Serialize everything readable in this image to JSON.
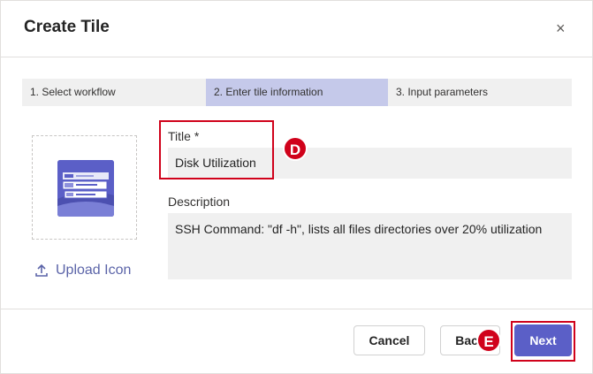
{
  "dialog": {
    "title": "Create Tile",
    "close_glyph": "×"
  },
  "stepper": {
    "steps": [
      {
        "label": "1. Select workflow",
        "active": false
      },
      {
        "label": "2. Enter tile information",
        "active": true
      },
      {
        "label": "3. Input parameters",
        "active": false
      }
    ]
  },
  "icon_panel": {
    "upload_label": "Upload Icon",
    "icon": "upload-icon"
  },
  "form": {
    "title_label": "Title *",
    "title_value": "Disk Utilization",
    "description_label": "Description",
    "description_value": "SSH Command: \"df -h\", lists all files directories over 20% utilization"
  },
  "annotations": {
    "d_label": "D",
    "e_label": "E",
    "color": "#d0021b"
  },
  "footer": {
    "cancel_label": "Cancel",
    "back_label": "Back",
    "next_label": "Next"
  },
  "colors": {
    "accent": "#5b5fc7",
    "active_step": "#c5c9ea",
    "field_bg": "#f0f0f0"
  }
}
